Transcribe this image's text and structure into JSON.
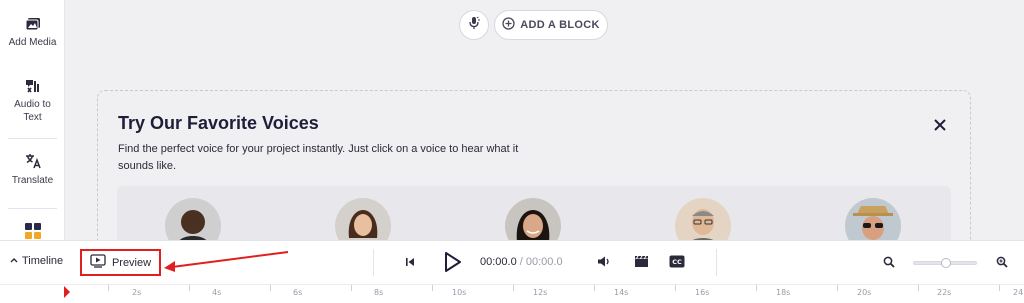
{
  "sidebar": {
    "items": [
      {
        "label": "Add Media",
        "icon": "add-media-icon"
      },
      {
        "label": "Audio to Text",
        "icon": "audio-to-text-icon"
      },
      {
        "label": "Translate",
        "icon": "translate-icon"
      },
      {
        "label": "",
        "icon": "templates-icon"
      }
    ]
  },
  "canvas": {
    "add_block_label": "ADD A BLOCK",
    "mic_icon": "microphone-icon",
    "add_icon": "plus-circle-icon"
  },
  "voices": {
    "title": "Try Our Favorite Voices",
    "description": "Find the perfect voice for your project instantly. Just click on a voice to hear what it sounds like.",
    "close_icon": "close-icon",
    "avatars": [
      "voice-avatar-1",
      "voice-avatar-2",
      "voice-avatar-3",
      "voice-avatar-4",
      "voice-avatar-5"
    ]
  },
  "toolbar": {
    "timeline_label": "Timeline",
    "preview_label": "Preview",
    "current_time": "00:00.0",
    "separator": " / ",
    "total_time": "00:00.0",
    "zoom_level": 0.5
  },
  "ruler": {
    "labels": [
      "2s",
      "4s",
      "6s",
      "8s",
      "10s",
      "12s",
      "14s",
      "16s",
      "18s",
      "20s",
      "22s",
      "24"
    ]
  },
  "colors": {
    "accent_red": "#e02020",
    "text_dark": "#1e1e3a"
  }
}
